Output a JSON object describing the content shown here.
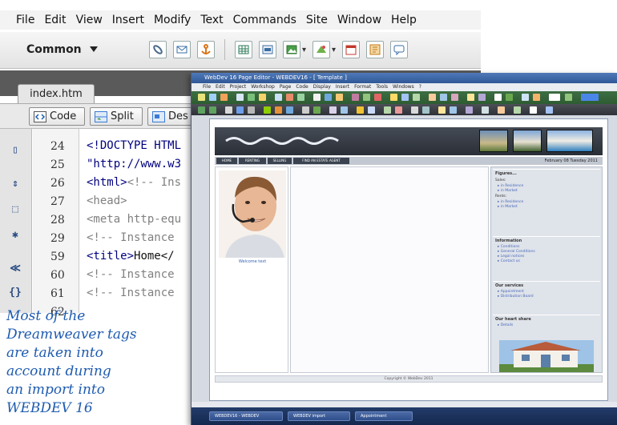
{
  "dreamweaver": {
    "menu": [
      "File",
      "Edit",
      "View",
      "Insert",
      "Modify",
      "Text",
      "Commands",
      "Site",
      "Window",
      "Help"
    ],
    "insert_category": "Common",
    "doc_tab": "index.htm",
    "view_buttons": [
      "Code",
      "Split",
      "Des"
    ],
    "line_numbers": [
      "24",
      "25",
      "26",
      "27",
      "28",
      "29",
      "59",
      "60",
      "61",
      "62"
    ],
    "code_lines": [
      {
        "tag": "<!DOCTYPE HTML",
        "rest": ""
      },
      {
        "tag": "\"http://www.w3",
        "rest": ""
      },
      {
        "tag": "<html>",
        "rest": "<!-- Ins"
      },
      {
        "tag": "<head>",
        "rest": ""
      },
      {
        "tag": "<meta http-equ",
        "rest": ""
      },
      {
        "tag": "<!-- Instance",
        "rest": ""
      },
      {
        "tag": "<title>",
        "rest": "Home</"
      },
      {
        "tag": "<!-- Instance",
        "rest": ""
      },
      {
        "tag": "<!-- Instance",
        "rest": ""
      },
      {
        "tag": "",
        "rest": ""
      }
    ]
  },
  "caption": [
    "Most of the",
    "Dreamweaver tags",
    "are taken into",
    "account during",
    "an import into",
    "WEBDEV 16"
  ],
  "webdev": {
    "title": "WebDev 16 Page Editor - WEBDEV16 - [ Template ]",
    "menu": [
      "File",
      "Edit",
      "Project",
      "Workshop",
      "Page",
      "Code",
      "Display",
      "Insert",
      "Format",
      "Tools",
      "Windows",
      "?"
    ],
    "page": {
      "date": "February 08 Tuesday 2011",
      "nav": [
        "HOME",
        "RENTING",
        "SELLING",
        "FIND AN ESTATE AGENT"
      ],
      "photo_caption": "Welcome text",
      "sidebar": [
        {
          "head": "Figures...",
          "items": [],
          "sub": [
            {
              "label": "Sales:",
              "items": [
                "in Residence",
                "in Market"
              ]
            },
            {
              "label": "Rents:",
              "items": [
                "in Residence",
                "in Market"
              ]
            }
          ]
        },
        {
          "head": "Information",
          "items": [
            "Conditions",
            "General Conditions",
            "Legal notices",
            "Contact us"
          ],
          "sub": []
        },
        {
          "head": "Our services",
          "items": [
            "Appointment",
            "Distribution Board"
          ],
          "sub": []
        },
        {
          "head": "Our heart share",
          "items": [
            "Details"
          ],
          "sub": []
        }
      ],
      "footer": "Copyright © WebDev 2011"
    },
    "status": "",
    "taskbar": [
      "WEBDEV16 - WEBDEV",
      "WEBDEV import",
      "Appointment"
    ]
  },
  "colors": {
    "caption": "#1e5bb0",
    "code_tag": "#00007f",
    "code_comment": "#808080"
  }
}
